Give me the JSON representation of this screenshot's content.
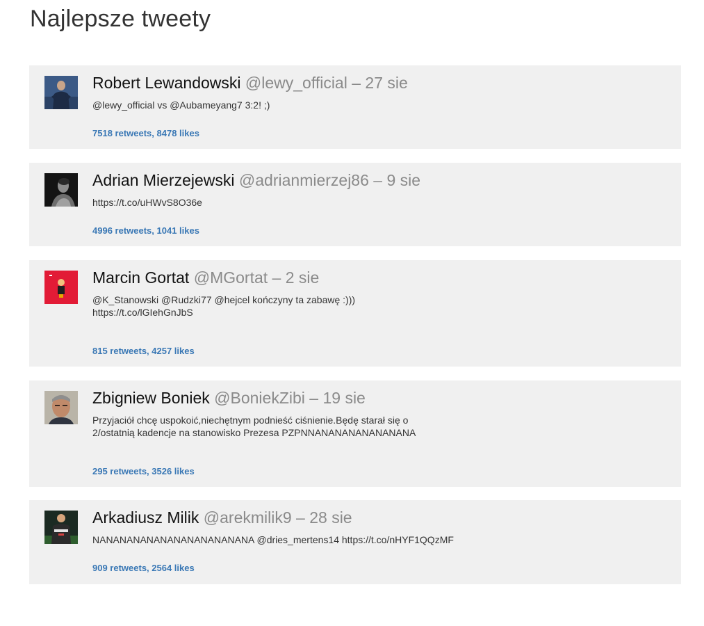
{
  "page": {
    "title": "Najlepsze tweety"
  },
  "tweets": [
    {
      "name": "Robert Lewandowski",
      "handle": "@lewy_official",
      "separator": "–",
      "date": "27 sie",
      "text": "@lewy_official vs @Aubameyang7 3:2! ;)",
      "stats": "7518 retweets, 8478 likes"
    },
    {
      "name": "Adrian Mierzejewski",
      "handle": "@adrianmierzej86",
      "separator": "–",
      "date": "9 sie",
      "text": "https://t.co/uHWvS8O36e",
      "stats": "4996 retweets, 1041 likes"
    },
    {
      "name": "Marcin Gortat",
      "handle": "@MGortat",
      "separator": "–",
      "date": "2 sie",
      "text": "@K_Stanowski @Rudzki77 @hejcel kończyny ta zabawę :))) https://t.co/lGIehGnJbS",
      "stats": "815 retweets, 4257 likes"
    },
    {
      "name": "Zbigniew Boniek",
      "handle": "@BoniekZibi",
      "separator": "–",
      "date": "19 sie",
      "text": "Przyjaciół chcę uspokoić,niechętnym podnieść ciśnienie.Będę starał się o 2/ostatnią kadencje na stanowisko Prezesa PZPNNANANANANANANANA",
      "stats": "295 retweets, 3526 likes"
    },
    {
      "name": "Arkadiusz Milik",
      "handle": "@arekmilik9",
      "separator": "–",
      "date": "28 sie",
      "text": "NANANANANANANANANANANANA @dries_mertens14 https://t.co/nHYF1QQzMF",
      "stats": "909 retweets, 2564 likes"
    }
  ]
}
